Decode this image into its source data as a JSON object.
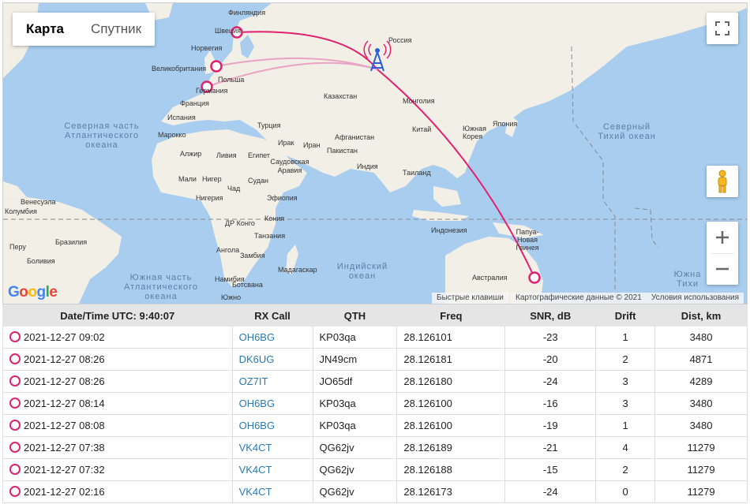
{
  "map": {
    "tabs": [
      {
        "label": "Карта",
        "active": true
      },
      {
        "label": "Спутник",
        "active": false
      }
    ],
    "attribution": {
      "shortcuts": "Быстрые клавиши",
      "data": "Картографические данные © 2021",
      "terms": "Условия использования"
    },
    "logo": "Google",
    "oceans": {
      "north_atlantic": "Северная часть Атлантического океана",
      "north_pacific": "Северный Тихий океан",
      "south_atlantic": "Южная часть Атлантического океана",
      "indian": "Индийский океан",
      "south_pacific": "Южна Тихи"
    },
    "countries": {
      "finland": "Финляндия",
      "sweden": "Швеция",
      "norway": "Норвегия",
      "uk": "Великобритания",
      "poland": "Польша",
      "germany": "Германия",
      "france": "Франция",
      "spain": "Испания",
      "russia": "Россия",
      "kazakhstan": "Казахстан",
      "mongolia": "Монголия",
      "china": "Китай",
      "japan": "Япония",
      "korea": "Южная Корея",
      "turkey": "Турция",
      "iraq": "Ирак",
      "iran": "Иран",
      "afghanistan": "Афганистан",
      "pakistan": "Пакистан",
      "india": "Индия",
      "saudi": "Саудовская Аравия",
      "thailand": "Таиланд",
      "algeria": "Алжир",
      "libya": "Ливия",
      "egypt": "Египет",
      "mali": "Мали",
      "niger": "Нигер",
      "sudan": "Судан",
      "chad": "Чад",
      "nigeria": "Нигерия",
      "ethiopia": "Эфиопия",
      "kenya": "Кения",
      "drc": "ДР Конго",
      "tanzania": "Танзания",
      "angola": "Ангола",
      "zambia": "Замбия",
      "namibia": "Намибия",
      "madagascar": "Мадагаскар",
      "botswana": "Ботсвана",
      "sa": "Южно",
      "indonesia": "Индонезия",
      "png": "Папуа-Новая Гвинея",
      "australia": "Австралия",
      "venezuela": "Венесуэла",
      "colombia": "Колумбия",
      "peru": "Перу",
      "brazil": "Бразилия",
      "bolivia": "Боливия",
      "morocco": "Марокко"
    }
  },
  "table": {
    "headers": {
      "time": "Date/Time UTC: 9:40:07",
      "call": "RX Call",
      "qth": "QTH",
      "freq": "Freq",
      "snr": "SNR, dB",
      "drift": "Drift",
      "dist": "Dist, km"
    },
    "rows": [
      {
        "time": "2021-12-27 09:02",
        "call": "OH6BG",
        "qth": "KP03qa",
        "freq": "28.126101",
        "snr": "-23",
        "drift": "1",
        "dist": "3480"
      },
      {
        "time": "2021-12-27 08:26",
        "call": "DK6UG",
        "qth": "JN49cm",
        "freq": "28.126181",
        "snr": "-20",
        "drift": "2",
        "dist": "4871"
      },
      {
        "time": "2021-12-27 08:26",
        "call": "OZ7IT",
        "qth": "JO65df",
        "freq": "28.126180",
        "snr": "-24",
        "drift": "3",
        "dist": "4289"
      },
      {
        "time": "2021-12-27 08:14",
        "call": "OH6BG",
        "qth": "KP03qa",
        "freq": "28.126100",
        "snr": "-16",
        "drift": "3",
        "dist": "3480"
      },
      {
        "time": "2021-12-27 08:08",
        "call": "OH6BG",
        "qth": "KP03qa",
        "freq": "28.126100",
        "snr": "-19",
        "drift": "1",
        "dist": "3480"
      },
      {
        "time": "2021-12-27 07:38",
        "call": "VK4CT",
        "qth": "QG62jv",
        "freq": "28.126189",
        "snr": "-21",
        "drift": "4",
        "dist": "11279"
      },
      {
        "time": "2021-12-27 07:32",
        "call": "VK4CT",
        "qth": "QG62jv",
        "freq": "28.126188",
        "snr": "-15",
        "drift": "2",
        "dist": "11279"
      },
      {
        "time": "2021-12-27 02:16",
        "call": "VK4CT",
        "qth": "QG62jv",
        "freq": "28.126173",
        "snr": "-24",
        "drift": "0",
        "dist": "11279"
      }
    ]
  },
  "colors": {
    "path": "#e0216f",
    "tower": "#2b5fd9",
    "land": "#f2efe6",
    "water": "#a9cdef",
    "link": "#2a7ab0"
  }
}
